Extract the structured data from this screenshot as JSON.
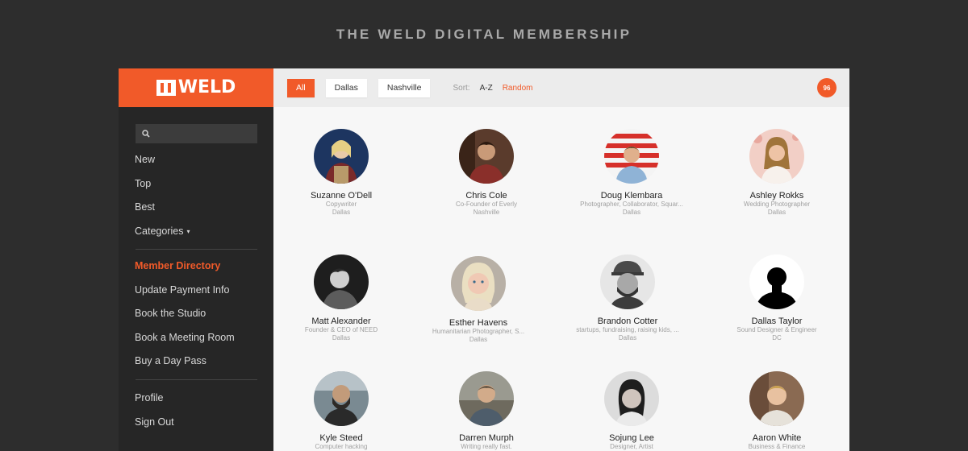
{
  "page_title": "THE WELD DIGITAL MEMBERSHIP",
  "brand": {
    "logo_text": "WELD",
    "accent": "#f15a29"
  },
  "sidebar": {
    "search_placeholder": "",
    "primary": [
      {
        "label": "New"
      },
      {
        "label": "Top"
      },
      {
        "label": "Best"
      },
      {
        "label": "Categories",
        "caret": "▾"
      }
    ],
    "member": [
      {
        "label": "Member Directory",
        "active": true
      },
      {
        "label": "Update Payment Info"
      },
      {
        "label": "Book the Studio"
      },
      {
        "label": "Book a Meeting Room"
      },
      {
        "label": "Buy a Day Pass"
      }
    ],
    "account": [
      {
        "label": "Profile"
      },
      {
        "label": "Sign Out"
      }
    ]
  },
  "toolbar": {
    "filters": [
      {
        "label": "All",
        "active": true
      },
      {
        "label": "Dallas"
      },
      {
        "label": "Nashville"
      }
    ],
    "sort_label": "Sort:",
    "sort_options": [
      {
        "label": "A-Z"
      },
      {
        "label": "Random",
        "active": true
      }
    ],
    "count": "96"
  },
  "members": [
    {
      "name": "Suzanne O'Dell",
      "role": "Copywriter",
      "city": "Dallas"
    },
    {
      "name": "Chris Cole",
      "role": "Co-Founder of Everly",
      "city": "Nashville"
    },
    {
      "name": "Doug Klembara",
      "role": "Photographer, Collaborator, Squar...",
      "city": "Dallas"
    },
    {
      "name": "Ashley Rokks",
      "role": "Wedding Photographer",
      "city": "Dallas"
    },
    {
      "name": "Matt Alexander",
      "role": "Founder & CEO of NEED",
      "city": "Dallas"
    },
    {
      "name": "Esther Havens",
      "role": "Humanitarian Photographer, S...",
      "city": "Dallas"
    },
    {
      "name": "Brandon Cotter",
      "role": "startups, fundraising, raising kids, ...",
      "city": "Dallas"
    },
    {
      "name": "Dallas Taylor",
      "role": "Sound Designer & Engineer",
      "city": "DC"
    },
    {
      "name": "Kyle Steed",
      "role": "Computer hacking",
      "city": ""
    },
    {
      "name": "Darren Murph",
      "role": "Writing really fast.",
      "city": ""
    },
    {
      "name": "Sojung Lee",
      "role": "Designer, Artist",
      "city": ""
    },
    {
      "name": "Aaron White",
      "role": "Business & Finance",
      "city": ""
    }
  ]
}
